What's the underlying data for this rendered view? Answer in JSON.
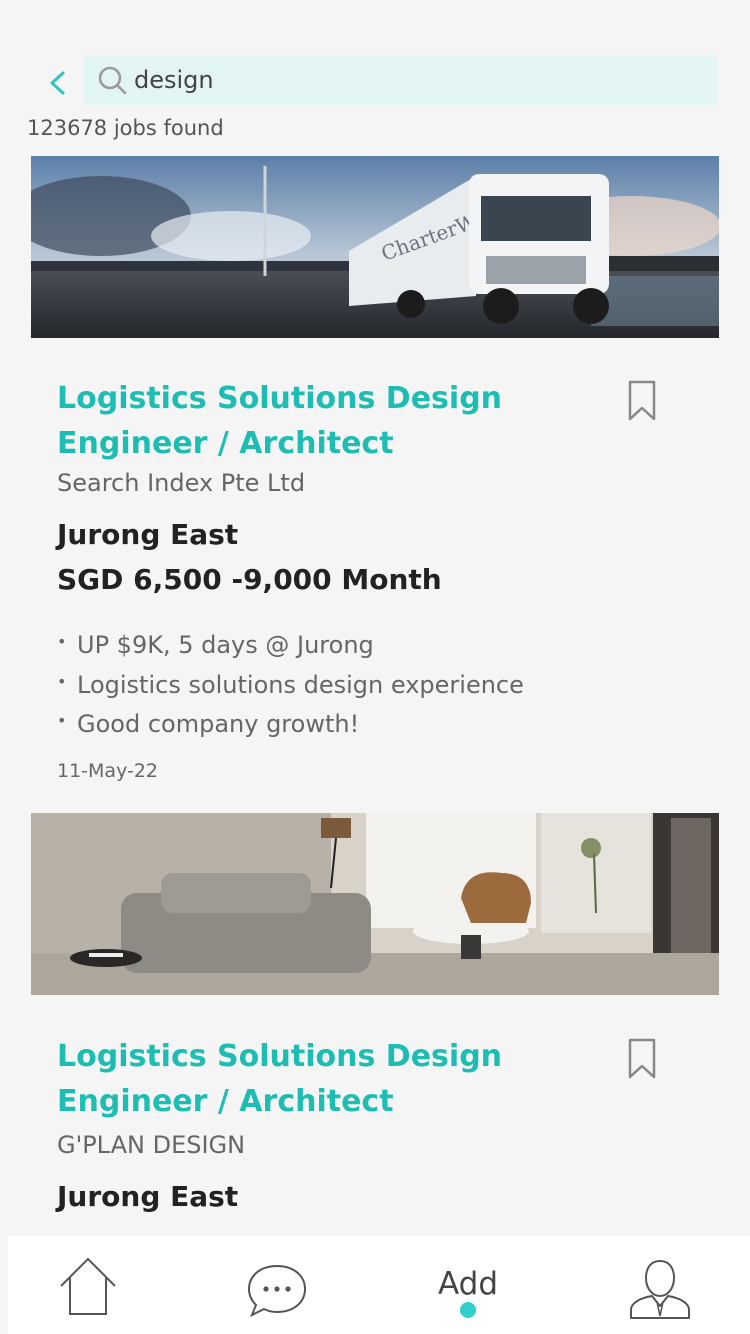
{
  "search": {
    "value": "design",
    "placeholder": ""
  },
  "results": {
    "count_text": "123678 jobs found"
  },
  "jobs": [
    {
      "title": "Logistics Solutions Design Engineer / Architect",
      "company": "Search Index Pte Ltd",
      "location": "Jurong East",
      "salary": "SGD 6,500 -9,000 Month",
      "highlights": [
        "UP $9K, 5 days @ Jurong",
        "Logistics solutions design experience",
        "Good company growth!"
      ],
      "date": "11-May-22",
      "image_text": "CharterWay"
    },
    {
      "title": "Logistics Solutions Design Engineer / Architect",
      "company": "G'PLAN DESIGN",
      "location": "Jurong East"
    }
  ],
  "tabbar": {
    "add_label": "Add"
  },
  "icons": {
    "back": "chevron-left-icon",
    "search": "search-icon",
    "bookmark": "bookmark-icon",
    "home": "home-icon",
    "chat": "chat-icon",
    "profile": "profile-icon"
  },
  "colors": {
    "accent": "#1dbdb3",
    "search_bg": "#e3f5f3",
    "page_bg": "#f5f5f5",
    "tab_dot": "#2fd0c9"
  }
}
